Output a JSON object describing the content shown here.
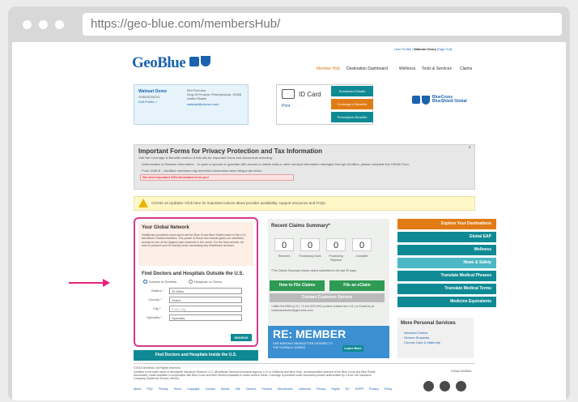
{
  "browser": {
    "url": "https://geo-blue.com/membersHub/"
  },
  "header": {
    "logo": "GeoBlue",
    "util_links": [
      "User Profile",
      "Walmart Demo",
      "[Sign Out]"
    ],
    "nav": [
      "Member Hub",
      "Destination Dashboard",
      "Wellness",
      "Tools & Services",
      "Claims"
    ]
  },
  "member": {
    "name": "Walmart Demo",
    "id": "GHB03246701",
    "edit": "Edit Profile »",
    "address": [
      "553 First Ave",
      "King Of Prussia, Pennsylvania, 19406",
      "United States"
    ],
    "email": "walmart@cmmcc.com"
  },
  "idcard": {
    "label": "ID Card",
    "print": "Print",
    "buttons": [
      "Enrollment Details",
      "Coverage & Benefits",
      "Prescription Benefits"
    ],
    "brand": "BlueCross BlueShield Global"
  },
  "privacy": {
    "title": "Important Forms for Privacy Protection and Tax Information",
    "subtitle": "Visit the Coverage & Benefits section of this site for important forms and documents including:",
    "items": [
      "Authorization to Release Information - To grant a spouse or guardian with access to claims data or other medical information managed through GeoBlue, please complete the HIPAA Form.",
      "Form 1095-B - GeoBlue members may need this information when filing a tax return.",
      "We need important SSN information from you!"
    ],
    "close": "x"
  },
  "covid": {
    "text": "COVID-19 Updates: Click here for important notices about provider availability, support resources and FAQs."
  },
  "network": {
    "title": "Your Global Network",
    "body": "Healthcare providers know and trust the Blue Cross Blue Shield name in the U.S. and Blues Global members. The power of these two brands gives our members access to one of the largest care networks in the world. For the best service, be sure to present your ID card(s) when accessing any healthcare services.",
    "find_title": "Find Doctors and Hospitals Outside the U.S.",
    "radio1": "Doctors or Dentists",
    "radio2": "Hospitals or Clinics",
    "fields": [
      {
        "label": "Radius *",
        "value": "25 Miles"
      },
      {
        "label": "Country *",
        "value": "Select"
      },
      {
        "label": "City *",
        "value": "Enter City"
      },
      {
        "label": "Specialty *",
        "value": "Specialty"
      }
    ],
    "search": "SEARCH",
    "inside_btn": "Find Doctors and Hospitals Inside the U.S."
  },
  "claims": {
    "title": "Recent Claims Summary*",
    "counts": [
      "0",
      "0",
      "0",
      "0"
    ],
    "labels": [
      "Received",
      "Processing Claim",
      "Processing Payment",
      "Complete"
    ],
    "note": "*The Claims Summary shows claims submitted in the last 90 days.",
    "btn_file": "How to File Claims",
    "btn_eclaim": "File an eClaim",
    "contact": "Contact Customer Service",
    "contact_text": "1.888.216.2050 (U.S.) +1.610.523.9911 (collect outside the U.S.) or Email Us at customerservice@geo-blue.com",
    "banner": "RE: MEMBER",
    "banner_sub": "OUR MONTHLY NEWSLETTER CATERED TO THE GLOBALLY MOBILE",
    "banner_btn": "Learn More"
  },
  "side": {
    "buttons": [
      "Explore Your Destinations",
      "Global EAP",
      "Wellness",
      "News & Safety",
      "Translate Medical Phrases",
      "Translate Medical Terms",
      "Medicine Equivalents"
    ],
    "more_title": "More Personal Services",
    "more_items": [
      "Informed Choice",
      "Service Requests",
      "Chronic Care & Maternity"
    ]
  },
  "footer": {
    "copyright": "©2018 GeoBlue. All Rights reserved.",
    "legal": "GeoBlue is the trade name of Worldwide Insurance Services, LLC (Worldwide Services Insurance Agency, LLC in California and New York), an independent licensee of the Blue Cross and Blue Shield Association, made available in cooperation with Blue Cross and Blue Shield companies in select service areas. Coverage is provided under insurance policies underwritten by 4 Ever Life Insurance Company (Oakbrook Terrace, Illinois).",
    "links": [
      "About",
      "FAQ",
      "Privacy",
      "Terms",
      "Copyright",
      "Contact",
      "Mobile Site",
      "Careers",
      "Product Disclosures",
      "California Privacy Rights",
      "EU GDPR Privacy Policy"
    ],
    "follow": "Follow GeoBlue"
  },
  "colors": {
    "brand": "#1a63ae",
    "accent": "#e07b16",
    "teal": "#0f8a94",
    "highlight": "#d23a8f"
  }
}
